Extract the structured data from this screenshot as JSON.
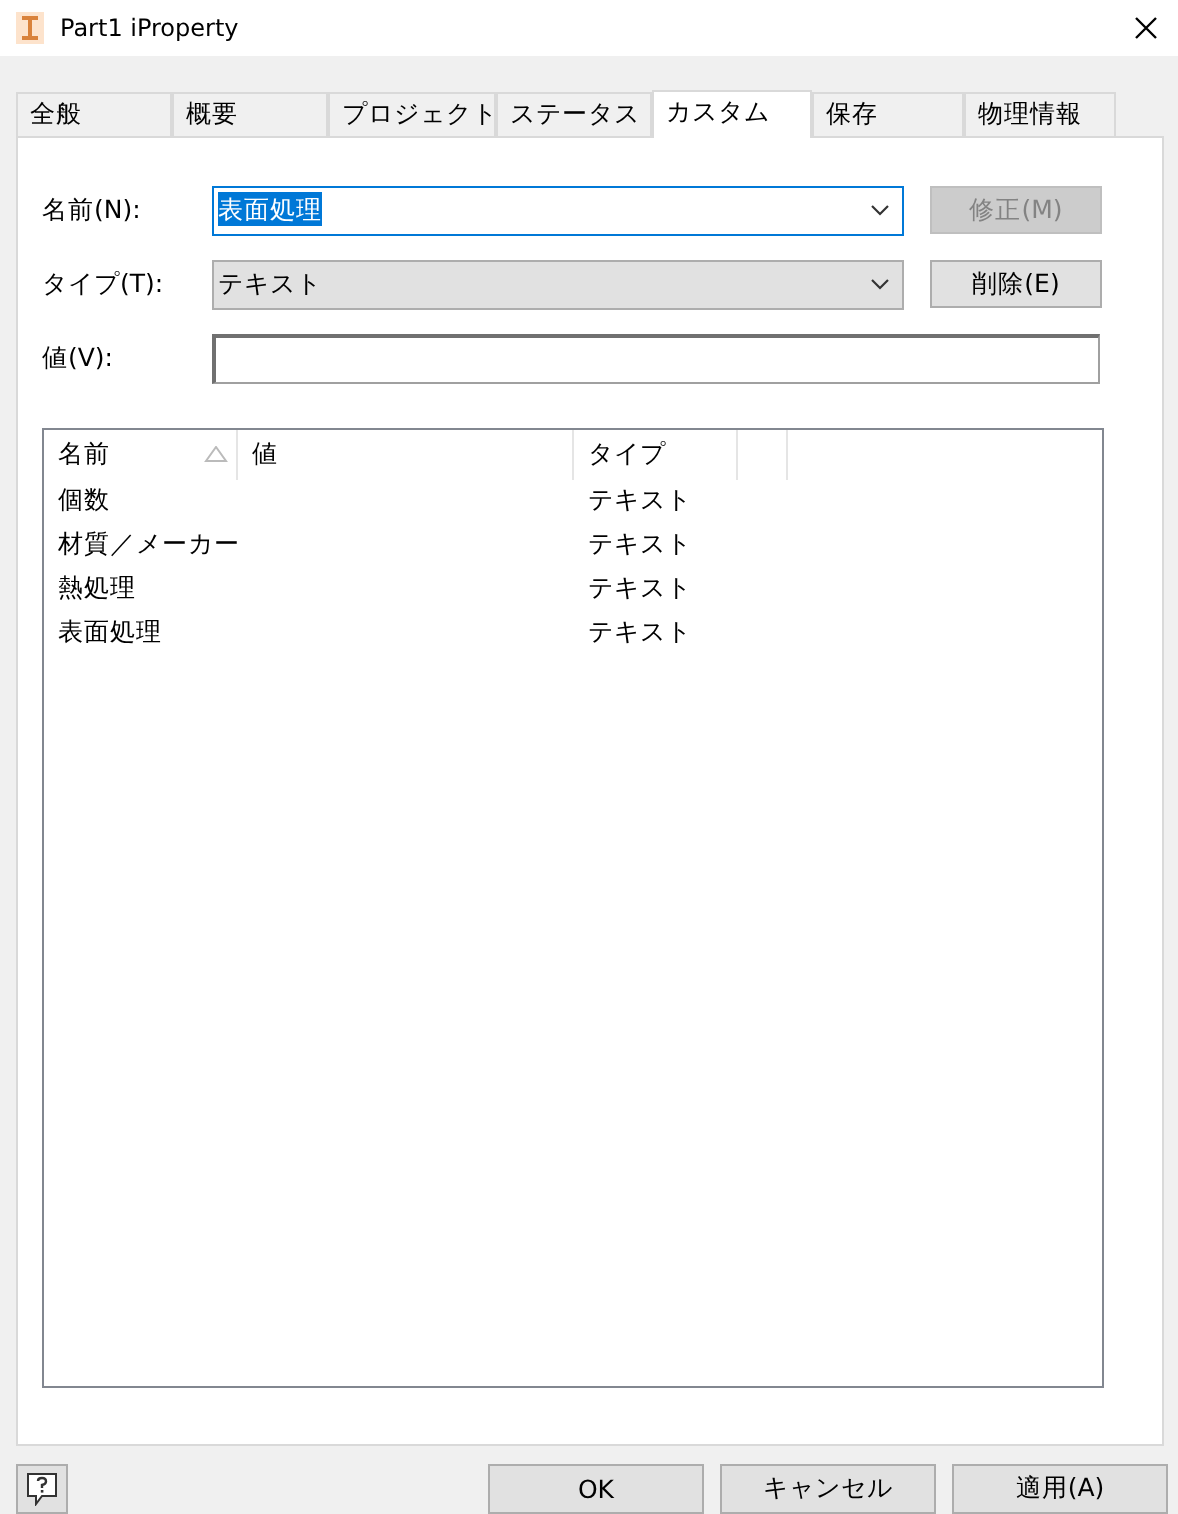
{
  "window": {
    "title": "Part1 iProperty"
  },
  "tabs": [
    {
      "label": "全般",
      "selected": false
    },
    {
      "label": "概要",
      "selected": false
    },
    {
      "label": "プロジェクト",
      "selected": false
    },
    {
      "label": "ステータス",
      "selected": false
    },
    {
      "label": "カスタム",
      "selected": true
    },
    {
      "label": "保存",
      "selected": false
    },
    {
      "label": "物理情報",
      "selected": false
    }
  ],
  "form": {
    "name_label": "名前(N):",
    "name_value": "表面処理",
    "name_selected": true,
    "modify_button": {
      "label": "修正(M)",
      "disabled": true
    },
    "type_label": "タイプ(T):",
    "type_value": "テキスト",
    "delete_button": {
      "label": "削除(E)",
      "disabled": false
    },
    "value_label": "値(V):"
  },
  "table": {
    "columns": [
      "名前",
      "値",
      "タイプ"
    ],
    "rows": [
      {
        "name": "個数",
        "type": "テキスト"
      },
      {
        "name": "材質／メーカー",
        "type": "テキスト"
      },
      {
        "name": "熱処理",
        "type": "テキスト"
      },
      {
        "name": "表面処理",
        "type": "テキスト"
      }
    ]
  },
  "buttons": [
    "OK",
    "キャンセル",
    "適用(A)"
  ]
}
